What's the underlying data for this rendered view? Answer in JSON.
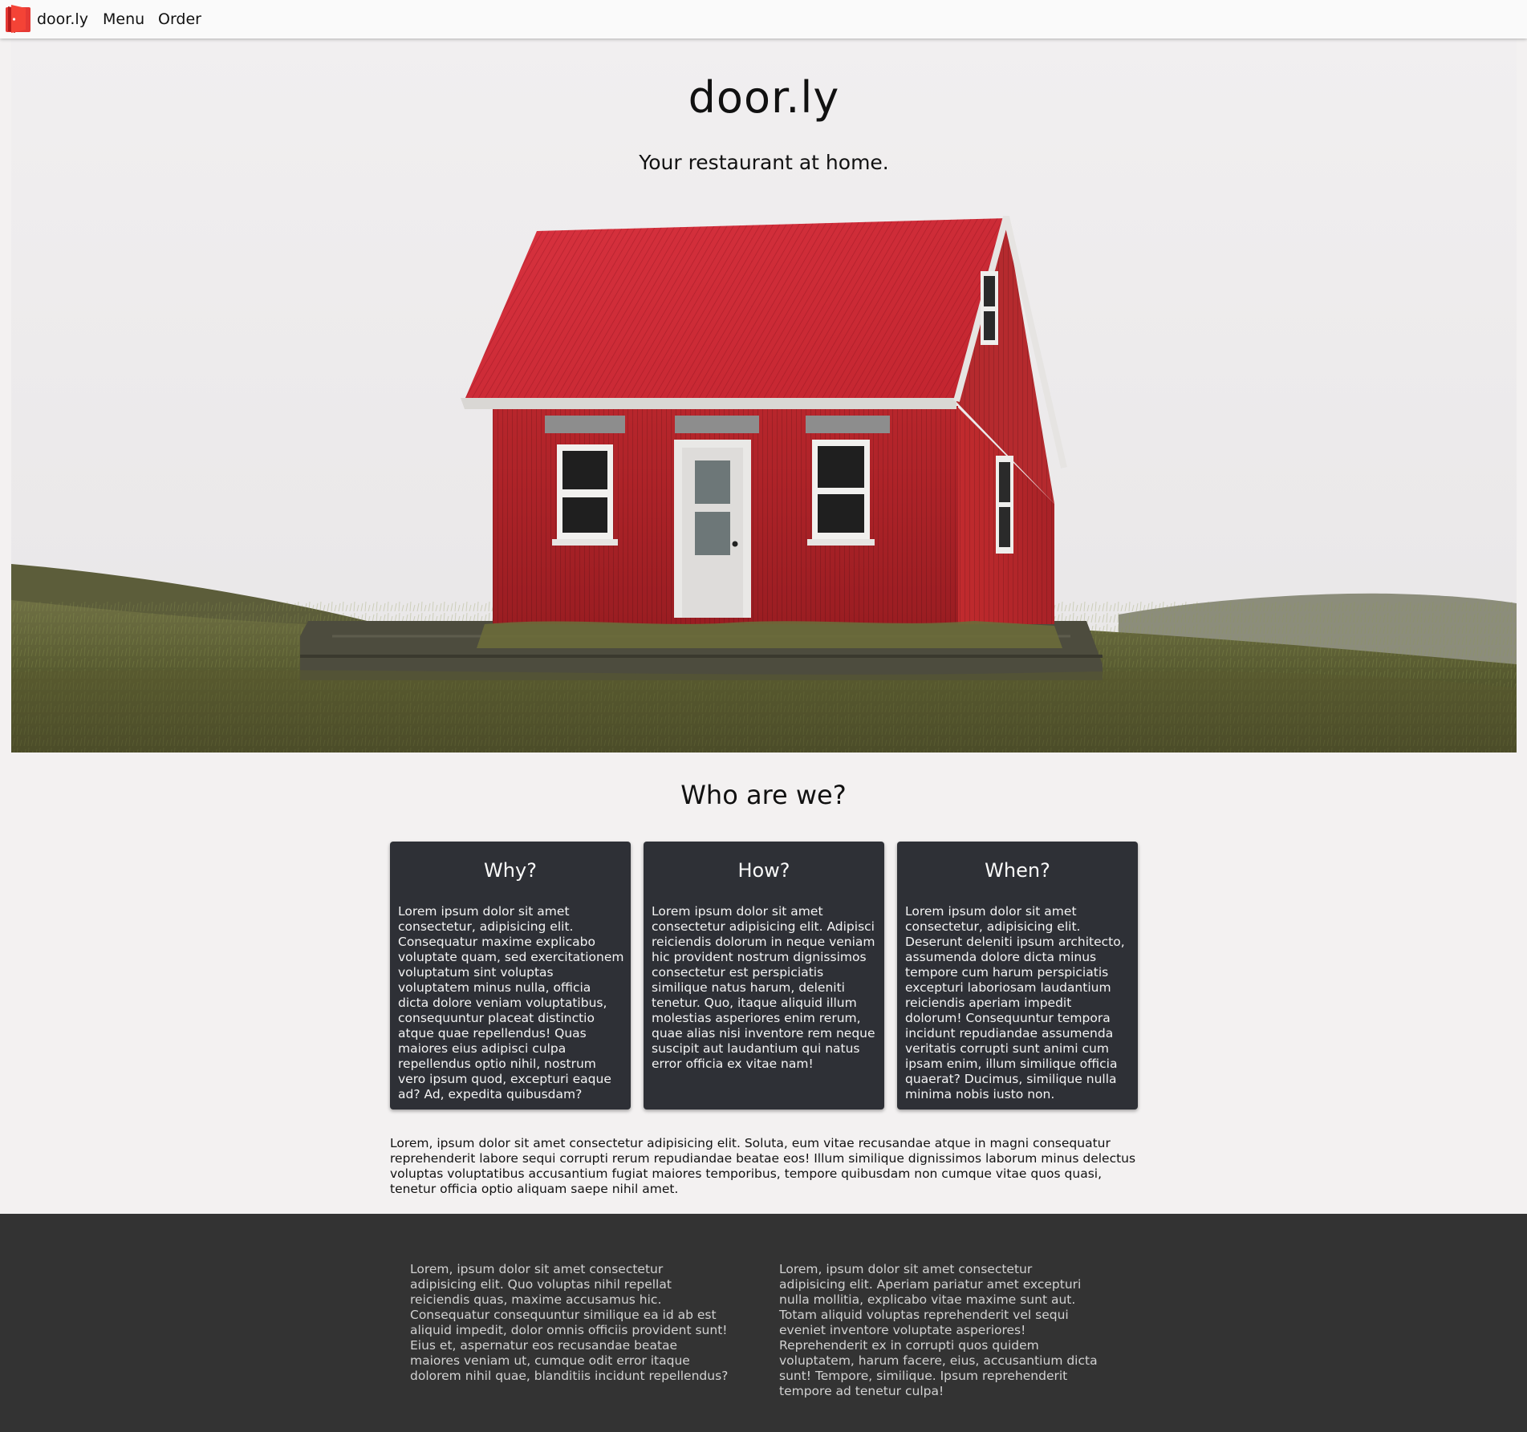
{
  "navbar": {
    "brand": "door.ly",
    "links": [
      "Menu",
      "Order"
    ],
    "logo_icon": "door-icon",
    "logo_color": "#e53935"
  },
  "hero": {
    "title": "door.ly",
    "subtitle": "Your restaurant at home.",
    "image": "red-house-on-hill"
  },
  "about": {
    "heading": "Who are we?",
    "cards": [
      {
        "title": "Why?",
        "body": "Lorem ipsum dolor sit amet consectetur, adipisicing elit. Consequatur maxime explicabo voluptate quam, sed exercitationem voluptatum sint voluptas voluptatem minus nulla, officia dicta dolore veniam voluptatibus, consequuntur placeat distinctio atque quae repellendus! Quas maiores eius adipisci culpa repellendus optio nihil, nostrum vero ipsum quod, excepturi eaque ad? Ad, expedita quibusdam?"
      },
      {
        "title": "How?",
        "body": "Lorem ipsum dolor sit amet consectetur adipisicing elit. Adipisci reiciendis dolorum in neque veniam hic provident nostrum dignissimos consectetur est perspiciatis similique natus harum, deleniti tenetur. Quo, itaque aliquid illum molestias asperiores enim rerum, quae alias nisi inventore rem neque suscipit aut laudantium qui natus error officia ex vitae nam!"
      },
      {
        "title": "When?",
        "body": "Lorem ipsum dolor sit amet consectetur, adipisicing elit. Deserunt deleniti ipsum architecto, assumenda dolore dicta minus tempore cum harum perspiciatis excepturi laboriosam laudantium reiciendis aperiam impedit dolorum! Consequuntur tempora incidunt repudiandae assumenda veritatis corrupti sunt animi cum ipsam enim, illum similique officia quaerat? Ducimus, similique nulla minima nobis iusto non."
      }
    ],
    "paragraph": "Lorem, ipsum dolor sit amet consectetur adipisicing elit. Soluta, eum vitae recusandae atque in magni consequatur reprehenderit labore sequi corrupti rerum repudiandae beatae eos! Illum similique dignissimos laborum minus delectus voluptas voluptatibus accusantium fugiat maiores temporibus, tempore quibusdam non cumque vitae quos quasi, tenetur officia optio aliquam saepe nihil amet."
  },
  "footer": {
    "columns": [
      "Lorem, ipsum dolor sit amet consectetur adipisicing elit. Quo voluptas nihil repellat reiciendis quas, maxime accusamus hic. Consequatur consequuntur similique ea id ab est aliquid impedit, dolor omnis officiis provident sunt! Eius et, aspernatur eos recusandae beatae maiores veniam ut, cumque odit error itaque dolorem nihil quae, blanditiis incidunt repellendus?",
      "Lorem, ipsum dolor sit amet consectetur adipisicing elit. Aperiam pariatur amet excepturi nulla mollitia, explicabo vitae maxime sunt aut. Totam aliquid voluptas reprehenderit vel sequi eveniet inventore voluptate asperiores! Reprehenderit ex in corrupti quos quidem voluptatem, harum facere, eius, accusantium dicta sunt! Tempore, similique. Ipsum reprehenderit tempore ad tenetur culpa!"
    ],
    "background": "#333333"
  }
}
